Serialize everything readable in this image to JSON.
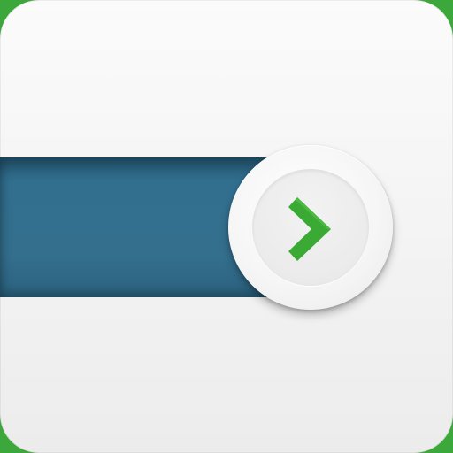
{
  "icon": {
    "background_color": "#f4f4f4",
    "border_color": "#3ca83c"
  },
  "slider": {
    "track_color": "#326f8f",
    "knob_color": "#f6f6f6",
    "knob_icon": "chevron-right-icon",
    "knob_icon_color": "#3aaa35"
  }
}
